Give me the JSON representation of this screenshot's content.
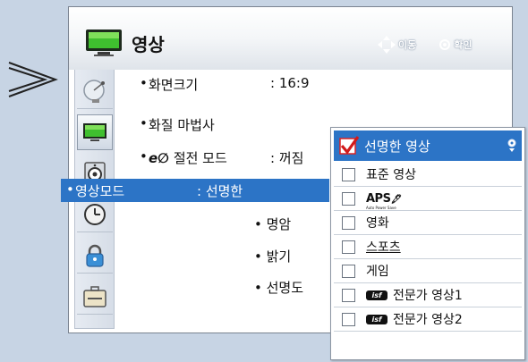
{
  "window": {
    "title": "영상"
  },
  "nav_hint": {
    "move_label": "이동",
    "ok_label": "확인"
  },
  "sidebar": {
    "items": [
      {
        "icon": "satellite-dish-icon"
      },
      {
        "icon": "tv-icon",
        "active": true
      },
      {
        "icon": "speaker-icon"
      },
      {
        "icon": "clock-icon"
      },
      {
        "icon": "lock-icon"
      },
      {
        "icon": "toolbox-icon"
      }
    ]
  },
  "menu": {
    "items": [
      {
        "label": "화면크기",
        "value": ": 16:9"
      },
      {
        "label": "화질 마법사",
        "value": ""
      },
      {
        "label": "절전 모드",
        "eco_mark": "e∅",
        "value": ": 꺼짐"
      },
      {
        "label": "영상모드",
        "value": ": 선명한",
        "selected": true
      }
    ],
    "sub_items": [
      "• 명암",
      "• 밝기",
      "• 선명도"
    ]
  },
  "dropdown": {
    "selected": "선명한 영상",
    "options": [
      {
        "label": "표준 영상"
      },
      {
        "label": "APS",
        "sublabel": "Auto Power Save"
      },
      {
        "label": "영화"
      },
      {
        "label": "스포츠"
      },
      {
        "label": "게임"
      },
      {
        "label": "전문가 영상1",
        "badge": "isf"
      },
      {
        "label": "전문가 영상2",
        "badge": "isf"
      }
    ]
  },
  "colors": {
    "accent": "#2c74c6",
    "background": "#c7d4e4"
  }
}
